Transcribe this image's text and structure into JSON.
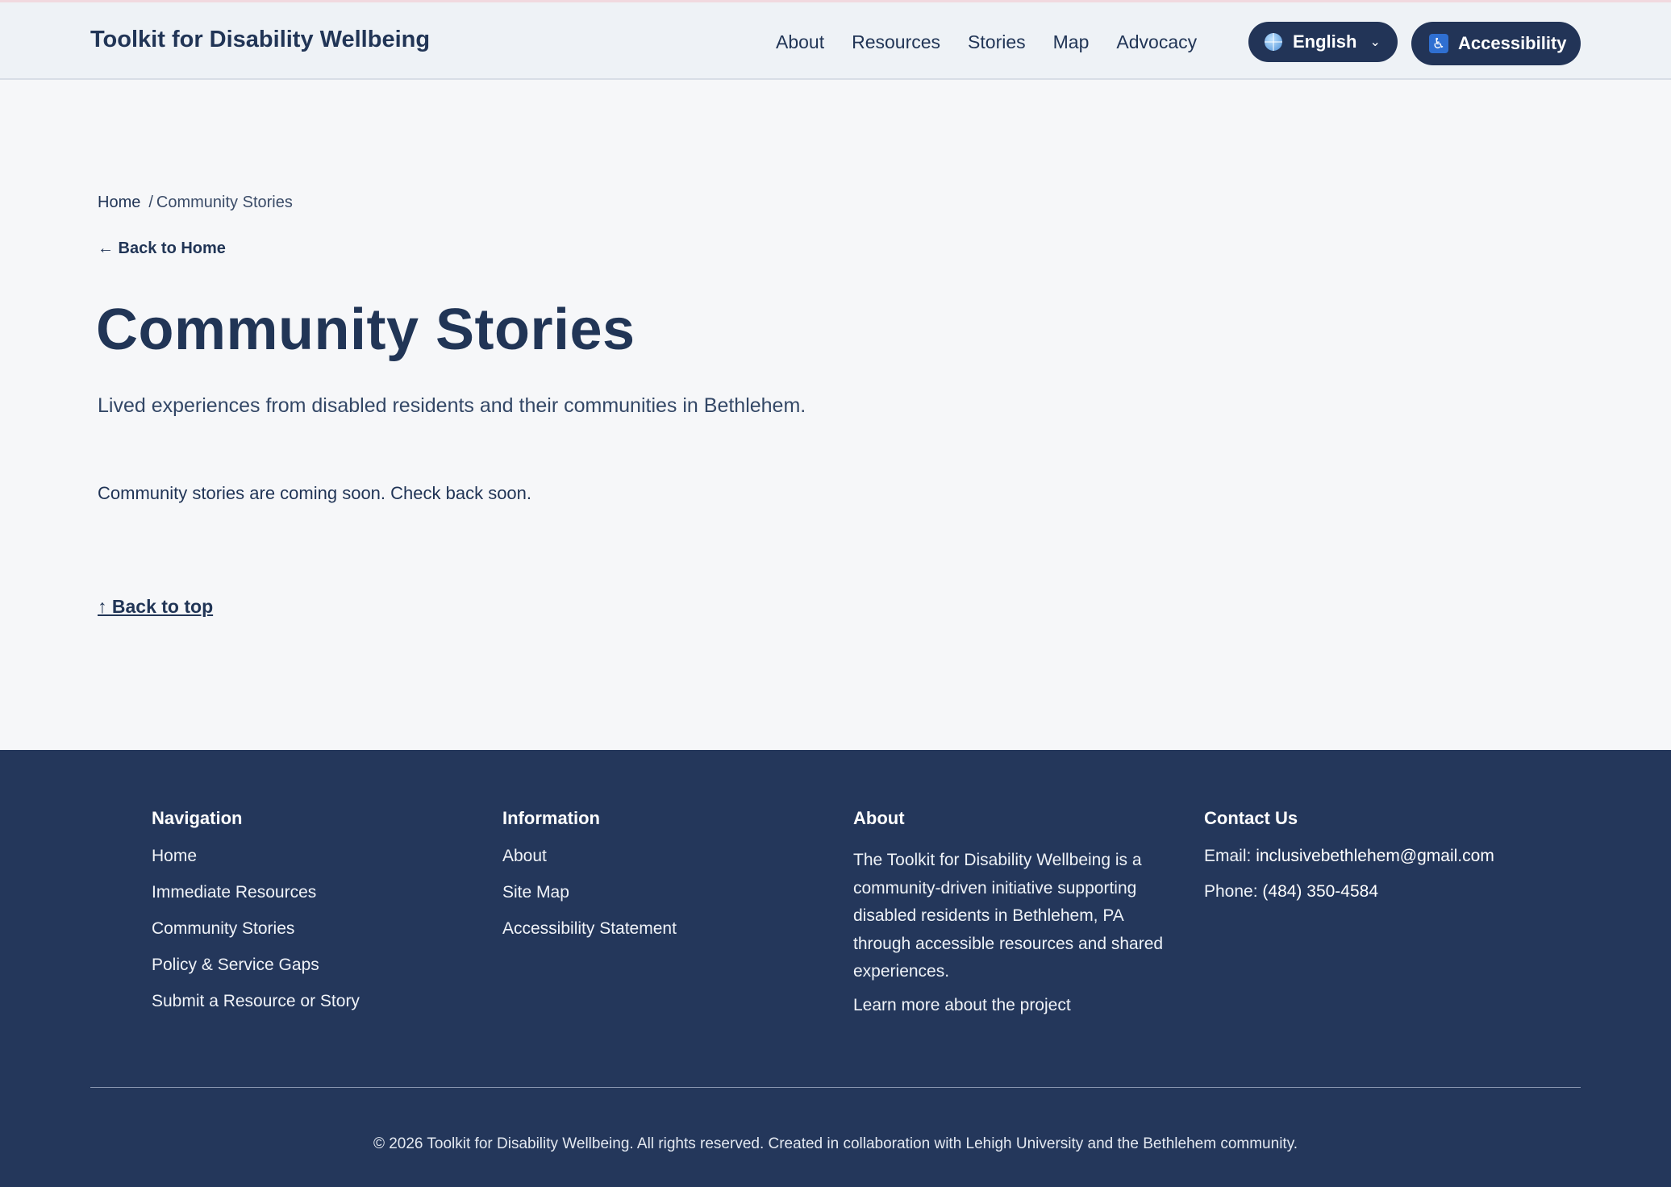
{
  "header": {
    "site_title": "Toolkit for Disability Wellbeing",
    "nav": [
      "About",
      "Resources",
      "Stories",
      "Map",
      "Advocacy"
    ],
    "language": {
      "label": "English",
      "icon": "globe-icon"
    },
    "accessibility": {
      "label": "Accessibility",
      "icon": "accessibility-icon"
    }
  },
  "breadcrumb": {
    "home": "Home",
    "separator": "/",
    "current": "Community Stories"
  },
  "back_home": "← Back to Home",
  "page": {
    "title": "Community Stories",
    "subtitle": "Lived experiences from disabled residents and their communities in Bethlehem.",
    "notice": "Community stories are coming soon. Check back soon.",
    "back_to_top": "↑ Back to top"
  },
  "footer": {
    "navigation": {
      "heading": "Navigation",
      "links": [
        "Home",
        "Immediate Resources",
        "Community Stories",
        "Policy & Service Gaps",
        "Submit a Resource or Story"
      ]
    },
    "information": {
      "heading": "Information",
      "links": [
        "About",
        "Site Map",
        "Accessibility Statement"
      ]
    },
    "about": {
      "heading": "About",
      "text": "The Toolkit for Disability Wellbeing is a community-driven initiative supporting disabled residents in Bethlehem, PA through accessible resources and shared experiences.",
      "link": "Learn more about the project"
    },
    "contact": {
      "heading": "Contact Us",
      "email_label": "Email:",
      "email": "inclusivebethlehem@gmail.com",
      "phone_label": "Phone:",
      "phone": "(484) 350-4584"
    },
    "copyright": "© 2026 Toolkit for Disability Wellbeing. All rights reserved. Created in collaboration with Lehigh University and the Bethlehem community."
  },
  "colors": {
    "navy": "#223457",
    "footer_bg": "#24375b",
    "page_bg": "#f6f7f9",
    "header_bg": "#eef2f6"
  }
}
